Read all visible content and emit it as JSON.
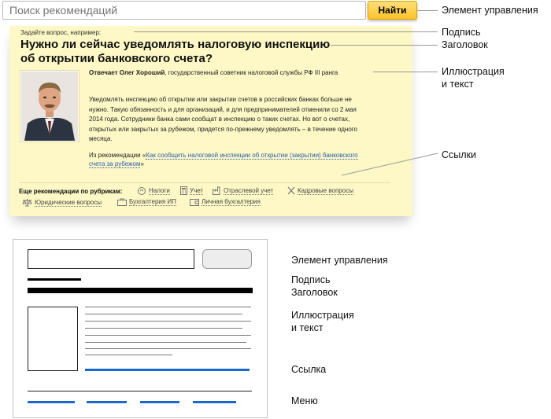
{
  "widget": {
    "search_placeholder": "Поиск рекомендаций",
    "search_button": "Найти",
    "hint": "Задайте вопрос, например:",
    "headline": "Нужно ли сейчас уведомлять налоговую инспекцию об открытии банковского счета?",
    "answer_prefix": "Отвечает",
    "answer_author": "Олег Хороший",
    "answer_role": ", государственный советник налоговой службы РФ III ранга",
    "body": "Уведомлять инспекцию об открытии или закрытии счетов в российских банках больше не нужно. Такую обязанность и для организаций, и для предпринимателей отменили со 2 мая 2014 года. Сотрудники банка сами сообщат в инспекцию о таких счетах. Но вот о счетах, открытых или закрытых за рубежом, придется по-прежнему уведомлять – в течение одного месяца.",
    "source_prefix": "Из рекомендации «",
    "source_link": "Как сообщить налоговой инспекции об открытии (закрытии) банковского счета за рубежом",
    "source_suffix": "»",
    "rubrics_label": "Еще рекомендации по рубрикам:",
    "rubrics": [
      {
        "label": "Налоги",
        "icon": "coins-icon"
      },
      {
        "label": "Учет",
        "icon": "calculator-icon"
      },
      {
        "label": "Отраслевой учет",
        "icon": "factory-icon"
      },
      {
        "label": "Кадровые вопросы",
        "icon": "tools-icon"
      },
      {
        "label": "Юридические вопросы",
        "icon": "scales-icon"
      },
      {
        "label": "Бухгалтерия ИП",
        "icon": "briefcase-icon"
      },
      {
        "label": "Личная бухгалтерия",
        "icon": "wallet-icon"
      }
    ]
  },
  "annotations_top": {
    "control": "Элемент управления",
    "caption": "Подпись",
    "title": "Заголовок",
    "illustration_1": "Иллюстрация",
    "illustration_2": "и текст",
    "links": "Ссылки"
  },
  "annotations_bottom": {
    "control": "Элемент управления",
    "caption": "Подпись",
    "title": "Заголовок",
    "illustration_1": "Иллюстрация",
    "illustration_2": "и текст",
    "link": "Ссылка",
    "menu": "Меню"
  },
  "colors": {
    "panel_bg": "#fdf8c5",
    "button_bg": "#fbc22a",
    "link": "#2a5db0",
    "wireframe_link": "#1967d2"
  }
}
